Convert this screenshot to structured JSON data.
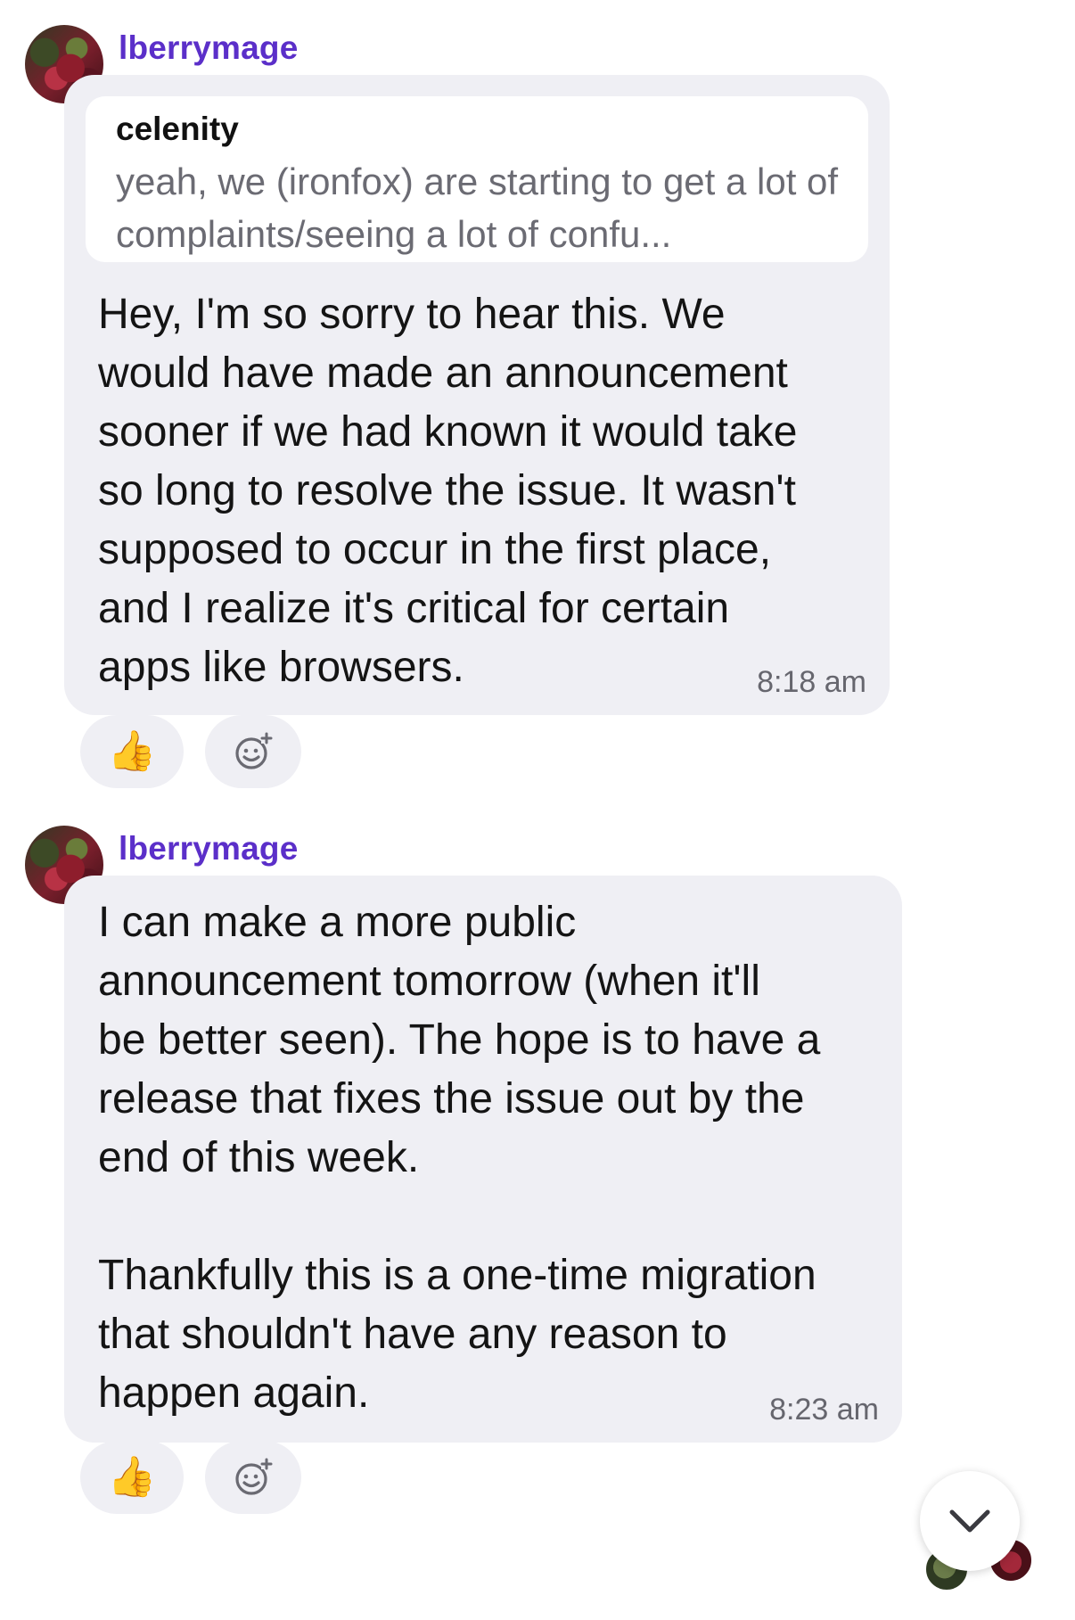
{
  "messages": [
    {
      "sender": "lberrymage",
      "reply_to": {
        "author": "celenity",
        "text": "yeah, we (ironfox) are starting to get a lot of complaints/seeing a lot of confu..."
      },
      "body": "Hey, I'm so sorry to hear this. We\nwould have made an announcement\nsooner if we had known it would take\nso long to resolve the issue. It wasn't\nsupposed to occur in the first place,\nand I realize it's critical for certain\napps like browsers.",
      "time": "8:18 am",
      "reactions": {
        "like": "👍",
        "add_icon": "add-reaction-icon"
      }
    },
    {
      "sender": "lberrymage",
      "body": "I can make a more public\nannouncement tomorrow (when it'll\nbe better seen). The hope is to have a\nrelease that fixes the issue out by the\nend of this week.\n\nThankfully this is a one-time migration\nthat shouldn't have any reason to\nhappen again.",
      "time": "8:23 am",
      "reactions": {
        "like": "👍",
        "add_icon": "add-reaction-icon"
      }
    }
  ],
  "scroll_button": {
    "icon": "chevron-down-icon"
  },
  "colors": {
    "sender": "#5b2fc9",
    "bubble": "#efeff4",
    "quote_bg": "#ffffff",
    "time": "#66666e"
  }
}
